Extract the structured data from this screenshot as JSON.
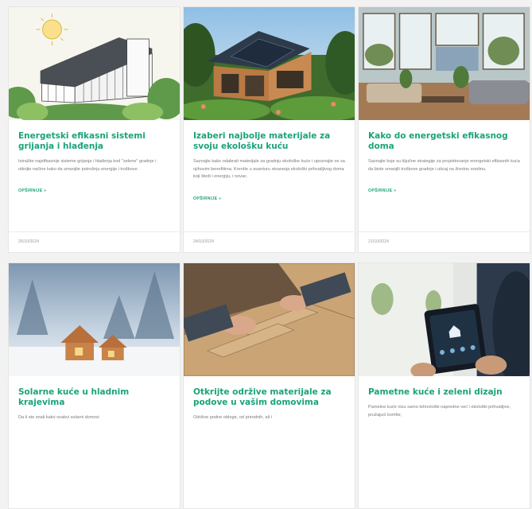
{
  "cards": [
    {
      "title": "Energetski efikasni sistemi grijanja i hlađenja",
      "excerpt": "Istražite najefikasnije sisteme grijanja i hlađenja kod \"zelene\" gradnje i otkrijte načine kako da smanjite potrošnju energije i troškove.",
      "more": "OPŠIRNIJE »",
      "date": "26/10/2024",
      "image_icon": "sketch-house-image"
    },
    {
      "title": "Izaberi najbolje materijale za svoju ekološku kuću",
      "excerpt": "Saznajte kako odabrati materijale za gradnju ekološke kuće i upoznajte se sa njihovim benefitima. Kreníte u avanturu stvaranja ekološki prihvatljivog doma koji štedi i energiju, i novac.",
      "more": "OPŠIRNIJE »",
      "date": "24/10/2024",
      "image_icon": "wooden-house-solar-image"
    },
    {
      "title": "Kako do energetski efikasnog doma",
      "excerpt": "Saznajte koje su ključne strategije za projektovanje energetski efikasnih kuća da biste smanjili troškove gradnje i uticaj na životnu sredinu.",
      "more": "OPŠIRNIJE »",
      "date": "21/10/2024",
      "image_icon": "living-room-image"
    },
    {
      "title": "Solarne kuće u hladnim krajevima",
      "excerpt": "Da li ste znali kako ovakvi solarni domovi",
      "image_icon": "snow-cabin-image"
    },
    {
      "title": "Otkrijte održive materijale za podove u vašim domovima",
      "excerpt": "Održive podne obloge, od prirodnih, ali i",
      "image_icon": "floor-install-image"
    },
    {
      "title": "Pametne kuće i zeleni dizajn",
      "excerpt": "Pametne kuće nisu samo tehnološki napredne već i ekološki prihvatljive, pružajući komfor,",
      "image_icon": "smart-tablet-image"
    }
  ],
  "colors": {
    "accent": "#1aa37a",
    "background": "#f1f2f1"
  }
}
